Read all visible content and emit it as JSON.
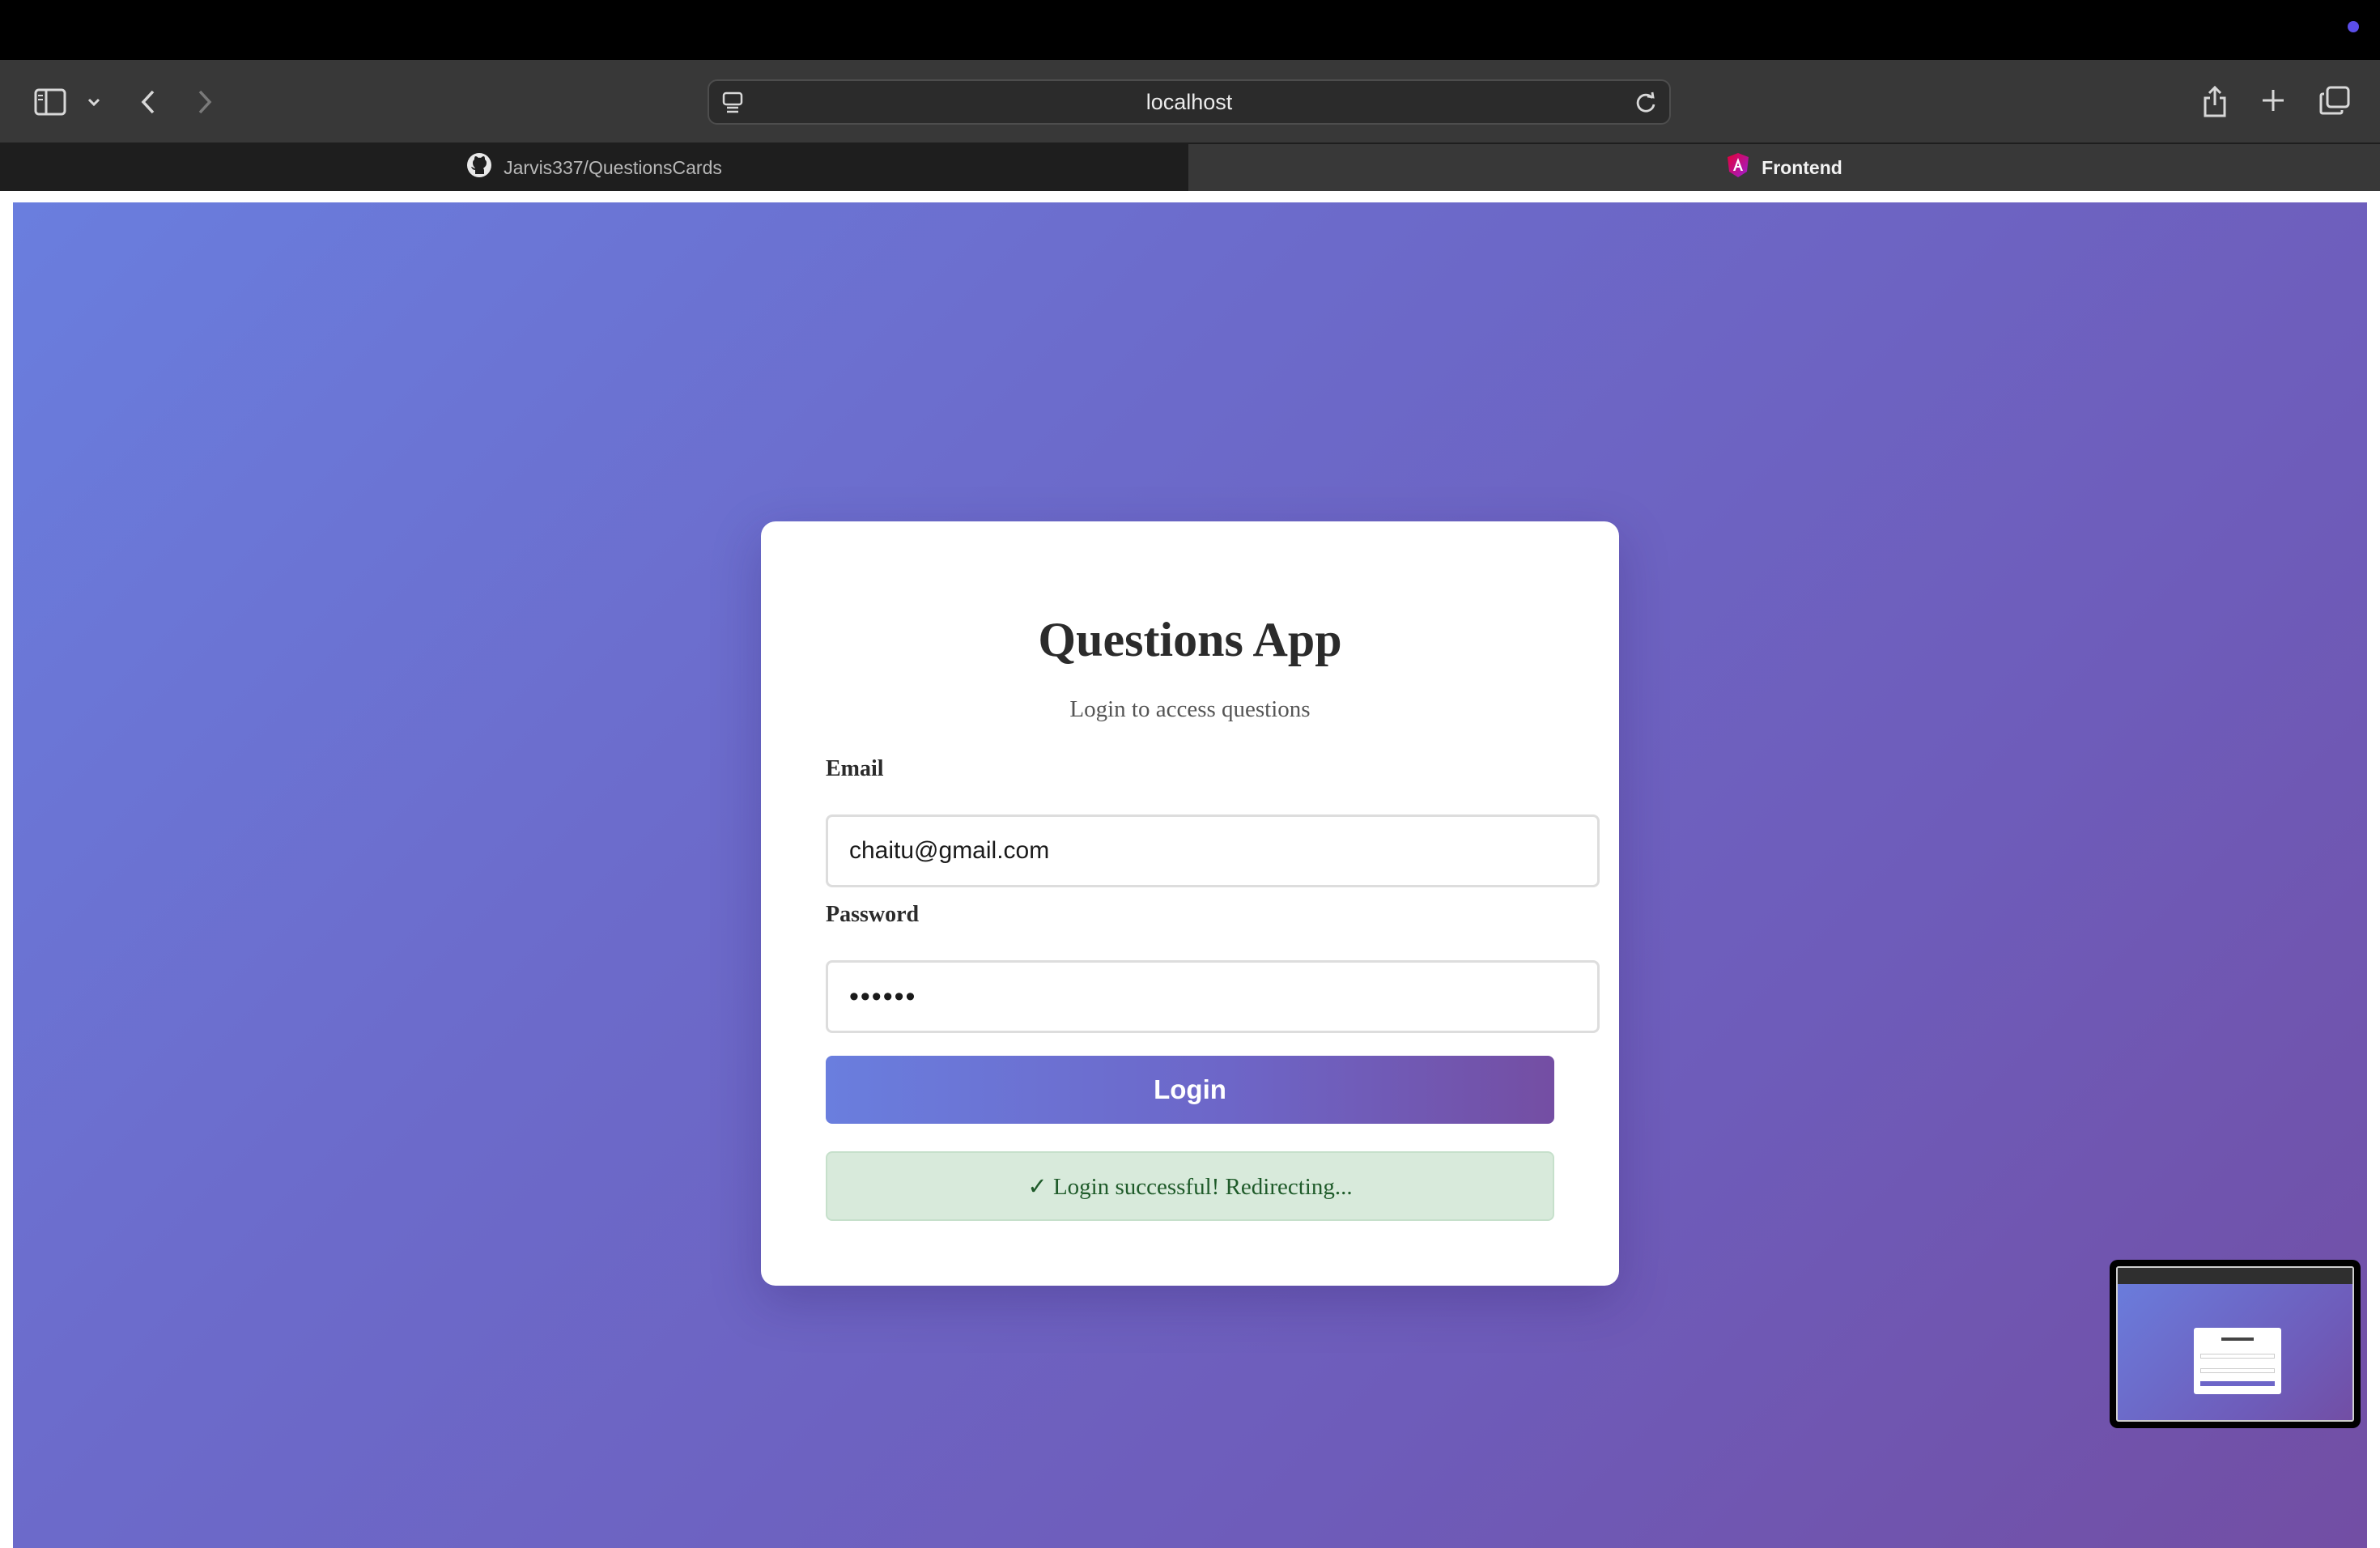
{
  "browser": {
    "url": "localhost",
    "tabs": [
      {
        "label": "Jarvis337/QuestionsCards",
        "icon": "github-icon",
        "active": false
      },
      {
        "label": "Frontend",
        "icon": "angular-icon",
        "active": true
      }
    ]
  },
  "login": {
    "title": "Questions App",
    "subtitle": "Login to access questions",
    "email_label": "Email",
    "email_value": "chaitu@gmail.com",
    "password_label": "Password",
    "password_value": "••••••",
    "button_label": "Login",
    "success_message": "✓ Login successful! Redirecting..."
  },
  "colors": {
    "gradient_start": "#6a7ede",
    "gradient_end": "#724ea4",
    "success_bg": "#d8eadb",
    "success_text": "#1f5b2a"
  }
}
